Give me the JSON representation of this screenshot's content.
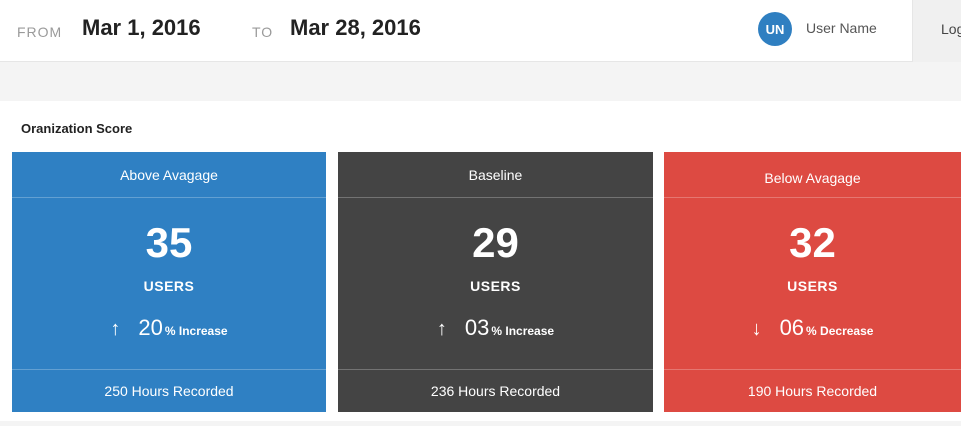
{
  "header": {
    "from_label": "FROM",
    "from_date": "Mar 1, 2016",
    "to_label": "TO",
    "to_date": "Mar 28, 2016",
    "avatar_initials": "UN",
    "user_name": "User Name",
    "logout_label": "Log"
  },
  "panel": {
    "title": "Oranization Score"
  },
  "cards": [
    {
      "title": "Above Avagage",
      "value": "35",
      "unit": "USERS",
      "arrow": "↑",
      "percent": "20",
      "change": "% Increase",
      "footer": "250 Hours Recorded",
      "color": "#2f80c3"
    },
    {
      "title": "Baseline",
      "value": "29",
      "unit": "USERS",
      "arrow": "↑",
      "percent": "03",
      "change": "% Increase",
      "footer": "236 Hours Recorded",
      "color": "#444444"
    },
    {
      "title": "Below Avagage",
      "value": "32",
      "unit": "USERS",
      "arrow": "↓",
      "percent": "06",
      "change": "% Decrease",
      "footer": "190 Hours Recorded",
      "color": "#dd4a42"
    }
  ],
  "colors": {
    "accent": "#2f7fc1"
  }
}
